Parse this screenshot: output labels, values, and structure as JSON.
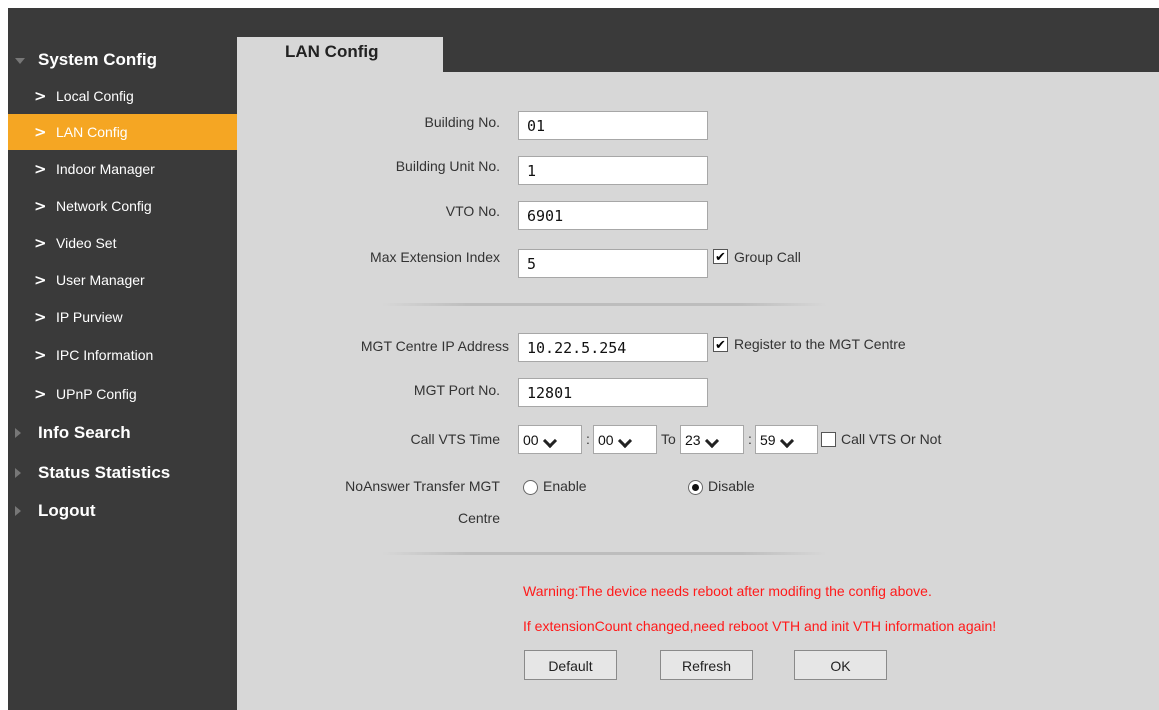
{
  "sidebar": {
    "sections": [
      {
        "label": "System Config",
        "expanded": true
      },
      {
        "label": "Info Search",
        "expanded": false
      },
      {
        "label": "Status Statistics",
        "expanded": false
      },
      {
        "label": "Logout",
        "expanded": false
      }
    ],
    "items": [
      {
        "label": "Local Config"
      },
      {
        "label": "LAN Config",
        "active": true
      },
      {
        "label": "Indoor Manager"
      },
      {
        "label": "Network Config"
      },
      {
        "label": "Video Set"
      },
      {
        "label": "User Manager"
      },
      {
        "label": "IP Purview"
      },
      {
        "label": "IPC Information"
      },
      {
        "label": "UPnP Config"
      }
    ],
    "chevron": ">",
    "active_color": "#f5a623"
  },
  "tab": {
    "label": "LAN Config"
  },
  "form": {
    "building_no": {
      "label": "Building No.",
      "value": "01"
    },
    "building_unit_no": {
      "label": "Building Unit No.",
      "value": "1"
    },
    "vto_no": {
      "label": "VTO No.",
      "value": "6901"
    },
    "max_extension_index": {
      "label": "Max Extension Index",
      "value": "5"
    },
    "group_call": {
      "label": "Group Call",
      "checked": true,
      "mark": "✔"
    },
    "mgt_ip": {
      "label": "MGT Centre IP Address",
      "value": "10.22.5.254"
    },
    "register_mgt": {
      "label": "Register to the MGT Centre",
      "checked": true,
      "mark": "✔"
    },
    "mgt_port": {
      "label": "MGT Port No.",
      "value": "12801"
    },
    "call_vts_time": {
      "label": "Call VTS Time",
      "start_hour": "00",
      "start_min": "00",
      "end_hour": "23",
      "end_min": "59",
      "colon": ":",
      "to": "To"
    },
    "call_vts_or_not": {
      "label": "Call VTS Or Not",
      "checked": false
    },
    "noanswer_transfer": {
      "label_line1": "NoAnswer Transfer MGT",
      "label_line2": "Centre",
      "enable_label": "Enable",
      "disable_label": "Disable",
      "selected": "Disable"
    }
  },
  "warnings": [
    "Warning:The device needs reboot after modifing the config above.",
    "If extensionCount changed,need reboot VTH and init VTH information again!"
  ],
  "buttons": {
    "default_label": "Default",
    "refresh_label": "Refresh",
    "ok_label": "OK"
  },
  "colors": {
    "warning": "#ff1a1a",
    "sidebar_bg": "#3a3a3a",
    "content_bg": "#d7d7d7"
  }
}
